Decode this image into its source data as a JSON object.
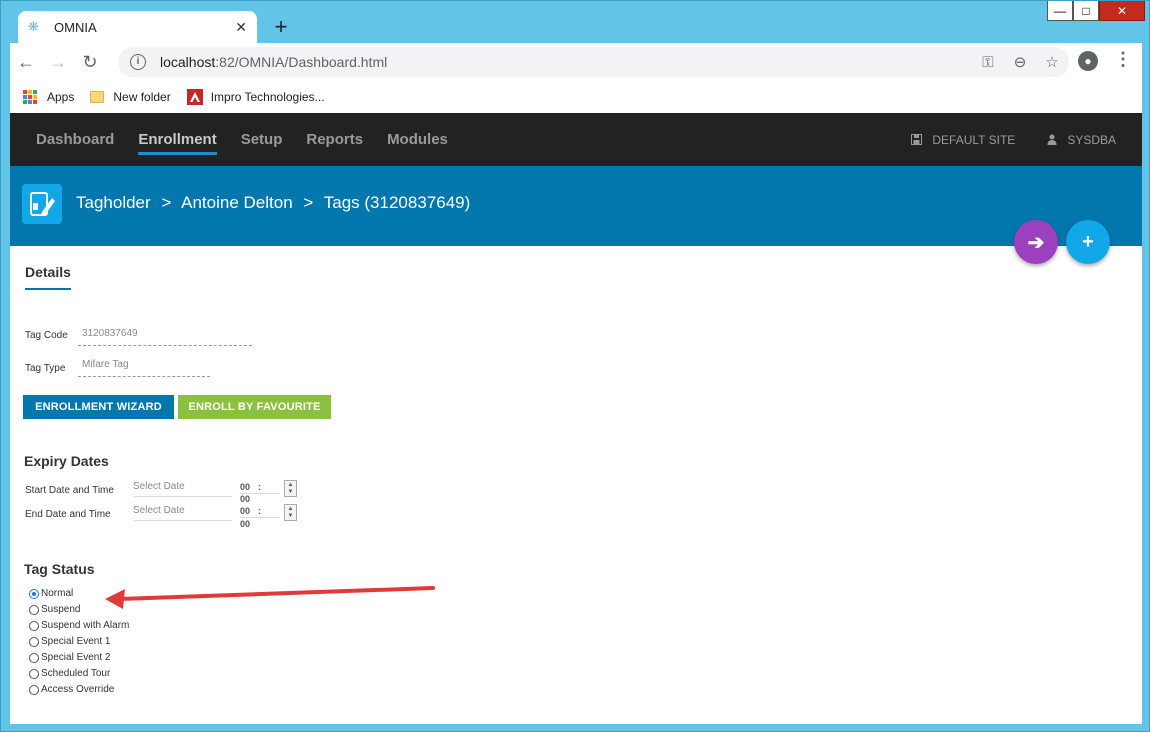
{
  "browser": {
    "tab_title": "OMNIA",
    "tab_close": "✕",
    "new_tab": "+",
    "url_host": "localhost",
    "url_path": ":82/OMNIA/Dashboard.html",
    "bookmarks": [
      "Apps",
      "New folder",
      "Impro Technologies..."
    ]
  },
  "app_nav": {
    "items": [
      "Dashboard",
      "Enrollment",
      "Setup",
      "Reports",
      "Modules"
    ],
    "active": "Enrollment",
    "site": "DEFAULT SITE",
    "user": "SYSDBA"
  },
  "header": {
    "crumb1": "Tagholder",
    "sep": ">",
    "crumb2": "Antoine Delton",
    "crumb3": "Tags (3120837649)"
  },
  "details": {
    "tab": "Details",
    "tag_code_label": "Tag Code",
    "tag_code_value": "3120837649",
    "tag_type_label": "Tag Type",
    "tag_type_value": "Mifare Tag",
    "btn_wizard": "ENROLLMENT WIZARD",
    "btn_favourite": "ENROLL BY FAVOURITE"
  },
  "expiry": {
    "title": "Expiry Dates",
    "start_label": "Start Date and Time",
    "end_label": "End Date and Time",
    "date_placeholder": "Select Date",
    "hour": "00",
    "colon": ":",
    "minute": "00"
  },
  "tag_status": {
    "title": "Tag Status",
    "options": [
      "Normal",
      "Suspend",
      "Suspend with Alarm",
      "Special Event 1",
      "Special Event 2",
      "Scheduled Tour",
      "Access Override"
    ],
    "selected": "Normal"
  },
  "colors": {
    "accent": "#0177ae",
    "favourite_green": "#8cc13f",
    "fab_purple": "#9b41c0",
    "fab_blue": "#12a8e8",
    "annotation_arrow": "#e03a3a"
  }
}
